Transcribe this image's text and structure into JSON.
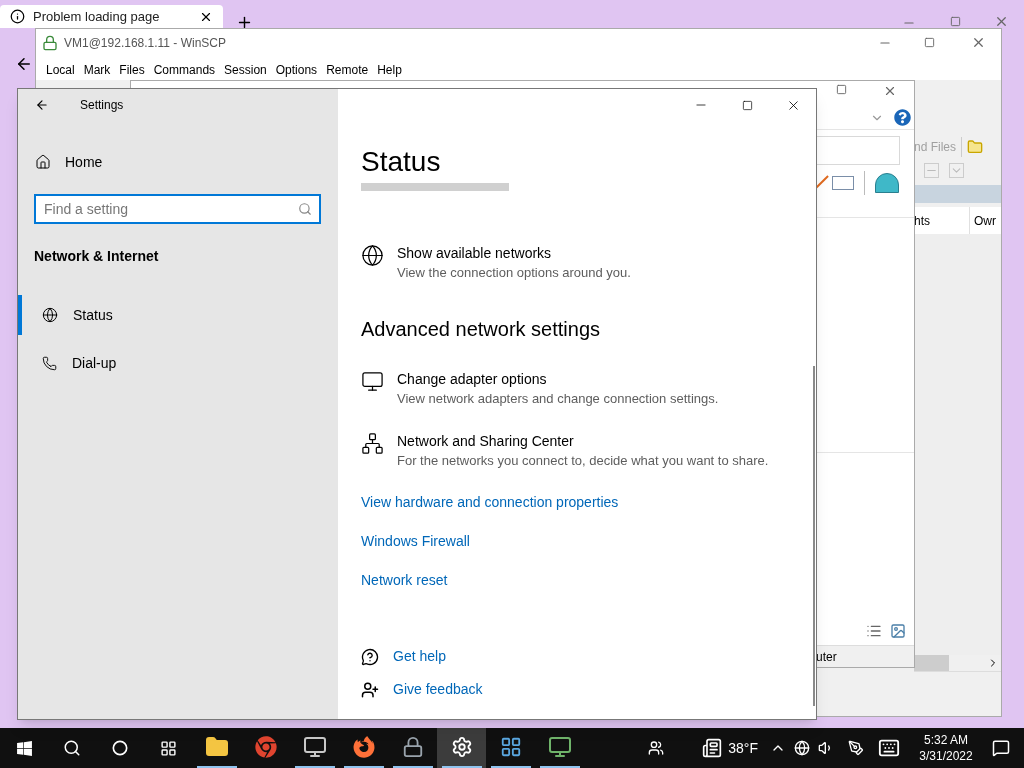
{
  "browser": {
    "tab_title": "Problem loading page"
  },
  "winscp": {
    "title": "VM1@192.168.1.11 - WinSCP",
    "menu": [
      "Local",
      "Mark",
      "Files",
      "Commands",
      "Session",
      "Options",
      "Remote",
      "Help"
    ],
    "find_files": "nd Files",
    "columns": [
      "hts",
      "Owr"
    ]
  },
  "explorer": {
    "status": "uter"
  },
  "settings": {
    "title": "Settings",
    "home": "Home",
    "search": {
      "placeholder": "Find a setting"
    },
    "category": "Network & Internet",
    "nav": [
      {
        "kind": "globe",
        "label": "Status",
        "selected": true
      },
      {
        "kind": "dialup",
        "label": "Dial-up",
        "selected": false
      }
    ],
    "page_title": "Status",
    "status_items": [
      {
        "kind": "globe",
        "title": "Show available networks",
        "subtitle": "View the connection options around you."
      }
    ],
    "section_title": "Advanced network settings",
    "advanced_items": [
      {
        "kind": "adapter",
        "title": "Change adapter options",
        "subtitle": "View network adapters and change connection settings."
      },
      {
        "kind": "sharing",
        "title": "Network and Sharing Center",
        "subtitle": "For the networks you connect to, decide what you want to share."
      }
    ],
    "links": [
      "View hardware and connection properties",
      "Windows Firewall",
      "Network reset"
    ],
    "help": [
      {
        "kind": "help",
        "label": "Get help"
      },
      {
        "kind": "feedback",
        "label": "Give feedback"
      }
    ]
  },
  "taskbar": {
    "apps": [
      {
        "kind": "explorer",
        "running": true,
        "selected": false
      },
      {
        "kind": "chrome",
        "running": false,
        "selected": false
      },
      {
        "kind": "monitor",
        "running": true,
        "selected": false
      },
      {
        "kind": "firefox",
        "running": true,
        "selected": false
      },
      {
        "kind": "winscp",
        "running": true,
        "selected": false
      },
      {
        "kind": "settings",
        "running": true,
        "selected": true
      },
      {
        "kind": "control",
        "running": true,
        "selected": false
      },
      {
        "kind": "remote",
        "running": true,
        "selected": false
      }
    ],
    "weather": "38°F",
    "time": "5:32 AM",
    "date": "3/31/2022"
  }
}
